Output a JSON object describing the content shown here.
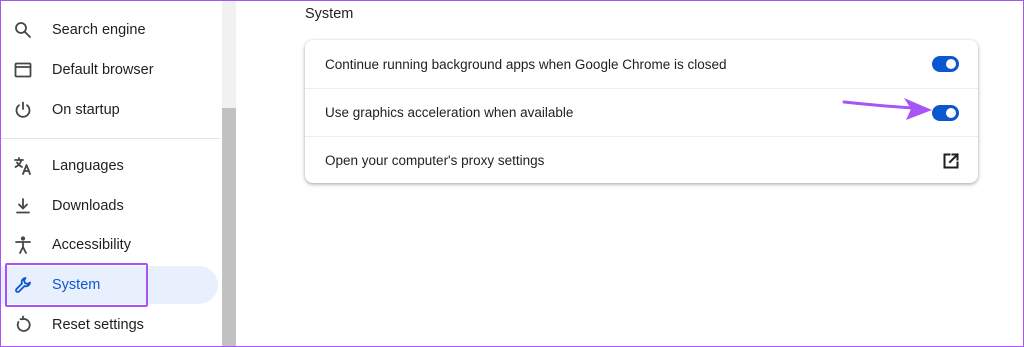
{
  "sidebar": {
    "items": [
      {
        "label": "Search engine",
        "icon": "search-icon"
      },
      {
        "label": "Default browser",
        "icon": "browser-window-icon"
      },
      {
        "label": "On startup",
        "icon": "power-icon"
      },
      {
        "label": "Languages",
        "icon": "translate-icon"
      },
      {
        "label": "Downloads",
        "icon": "download-icon"
      },
      {
        "label": "Accessibility",
        "icon": "accessibility-icon"
      },
      {
        "label": "System",
        "icon": "wrench-icon",
        "active": true
      },
      {
        "label": "Reset settings",
        "icon": "reset-icon"
      }
    ]
  },
  "main": {
    "section_title": "System",
    "rows": [
      {
        "label": "Continue running background apps when Google Chrome is closed",
        "control": "toggle",
        "enabled": true
      },
      {
        "label": "Use graphics acceleration when available",
        "control": "toggle",
        "enabled": true
      },
      {
        "label": "Open your computer's proxy settings",
        "control": "external-link-icon"
      }
    ]
  },
  "colors": {
    "accent": "#0b57d0",
    "active_bg": "#e8f0fe",
    "annotation": "#a855f7"
  }
}
